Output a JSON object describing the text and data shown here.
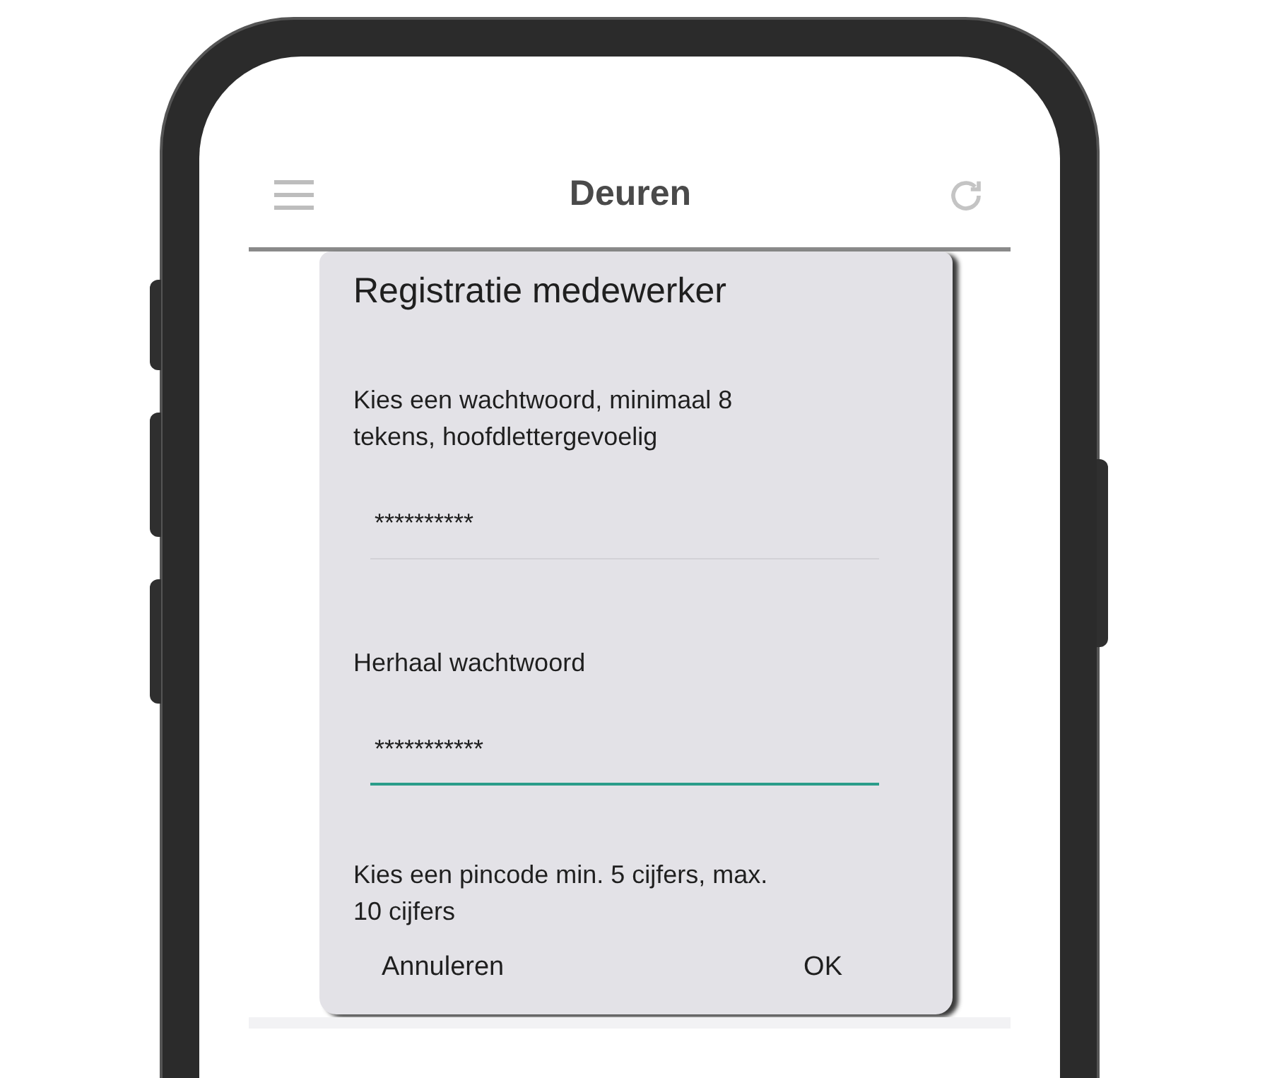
{
  "app_bar": {
    "title": "Deuren"
  },
  "dialog": {
    "title": "Registratie medewerker",
    "fields": [
      {
        "label": "Kies een wachtwoord, minimaal 8 tekens, hoofdlettergevoelig",
        "value": "**********",
        "focused": false
      },
      {
        "label": "Herhaal wachtwoord",
        "value": "***********",
        "focused": true
      }
    ],
    "hint": "Kies een pincode min. 5 cijfers, max. 10 cijfers",
    "buttons": [
      "Annuleren",
      "OK"
    ]
  }
}
